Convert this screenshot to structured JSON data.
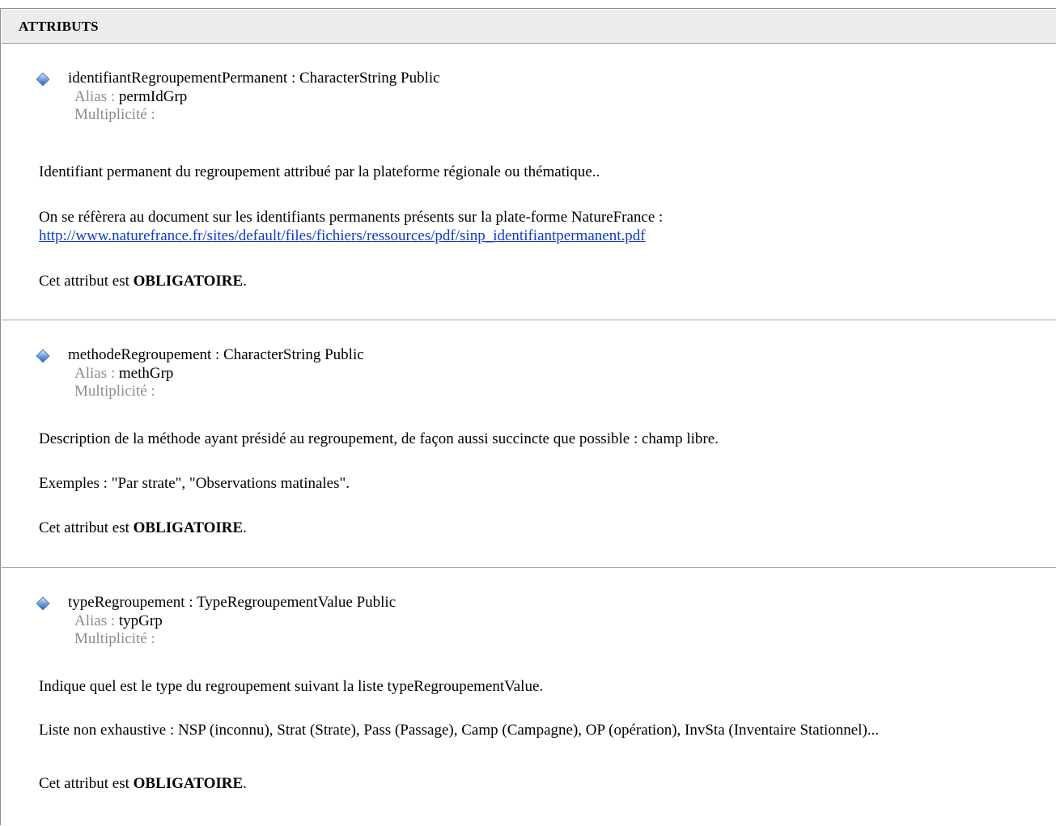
{
  "section": {
    "title": "ATTRIBUTS"
  },
  "attributes": [
    {
      "signature": "identifiantRegroupementPermanent : CharacterString  Public",
      "alias_label": "Alias : ",
      "alias_value": "permIdGrp",
      "multiplicity_label": "Multiplicité :",
      "description": "Identifiant permanent du regroupement attribué par la plateforme régionale ou thématique..",
      "reference_text": "On se réfèrera au document sur les identifiants permanents présents sur la plate-forme NatureFrance :",
      "reference_link": "http://www.naturefrance.fr/sites/default/files/fichiers/ressources/pdf/sinp_identifiantpermanent.pdf",
      "required_prefix": "Cet attribut est ",
      "required_word": "OBLIGATOIRE",
      "required_suffix": "."
    },
    {
      "signature": "methodeRegroupement : CharacterString  Public",
      "alias_label": "Alias : ",
      "alias_value": "methGrp",
      "multiplicity_label": "Multiplicité :",
      "description": "Description de la méthode ayant présidé au regroupement, de façon aussi succincte que possible : champ libre.",
      "examples": "Exemples : \"Par strate\", \"Observations matinales\".",
      "required_prefix": "Cet attribut est ",
      "required_word": "OBLIGATOIRE",
      "required_suffix": "."
    },
    {
      "signature": "typeRegroupement : TypeRegroupementValue  Public",
      "alias_label": "Alias : ",
      "alias_value": "typGrp",
      "multiplicity_label": "Multiplicité :",
      "description": "Indique quel est le type du regroupement suivant la liste typeRegroupementValue.",
      "list_text": "Liste non exhaustive : NSP (inconnu), Strat (Strate), Pass (Passage), Camp (Campagne), OP (opération), InvSta (Inventaire Stationnel)...",
      "required_prefix": "Cet attribut est ",
      "required_word": "OBLIGATOIRE",
      "required_suffix": "."
    }
  ]
}
